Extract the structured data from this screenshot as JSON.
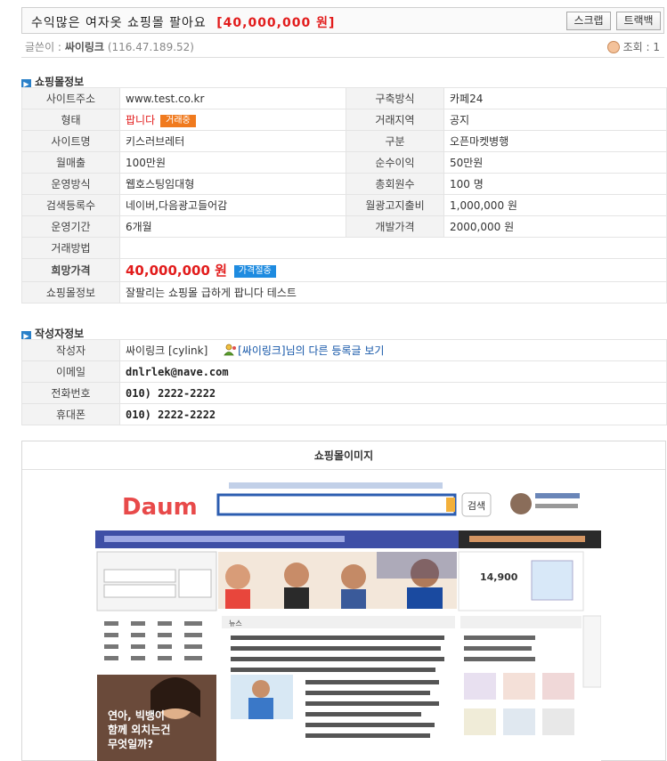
{
  "header": {
    "title": "수익많은 여자옷 쇼핑몰 팔아요",
    "price_tag": "[40,000,000 원]",
    "scrap_label": "스크랩",
    "trackback_label": "트랙백"
  },
  "meta": {
    "author_label": "글쓴이 :",
    "author_name": "싸이링크",
    "author_ip": "(116.47.189.52)",
    "views_label": "조회 : 1"
  },
  "shop_info": {
    "section_title": "쇼핑몰정보",
    "rows": [
      {
        "l1": "사이트주소",
        "v1": "www.test.co.kr",
        "l2": "구축방식",
        "v2": "카페24"
      },
      {
        "l1": "형태",
        "v1": "팝니다",
        "badge": "거래중",
        "l2": "거래지역",
        "v2": "공지"
      },
      {
        "l1": "사이트명",
        "v1": "키스러브레터",
        "l2": "구분",
        "v2": "오픈마켓병행"
      },
      {
        "l1": "월매출",
        "v1": "100만원",
        "l2": "순수이익",
        "v2": "50만원"
      },
      {
        "l1": "운영방식",
        "v1": "웹호스팅임대형",
        "l2": "총회원수",
        "v2": "100 명"
      },
      {
        "l1": "검색등록수",
        "v1": "네이버,다음광고들어감",
        "l2": "월광고지출비",
        "v2": "1,000,000 원"
      },
      {
        "l1": "운영기간",
        "v1": "6개월",
        "l2": "개발가격",
        "v2": "2000,000 원"
      }
    ],
    "method_label": "거래방법",
    "method_value": "",
    "price_label": "희망가격",
    "price_value": "40,000,000 원",
    "price_badge": "가격절충",
    "desc_label": "쇼핑몰정보",
    "desc_value": "잘팔리는 쇼핑몰 급하게 팝니다 테스트"
  },
  "author_info": {
    "section_title": "작성자정보",
    "writer_label": "작성자",
    "writer_value": "싸이링크 [cylink]",
    "writer_link_name": "[싸이링크]",
    "writer_link_suffix": "님의 다른 등록글 보기",
    "email_label": "이메일",
    "email_value": "dnlrlek@nave.com",
    "phone_label": "전화번호",
    "phone_value": "010) 2222-2222",
    "mobile_label": "휴대폰",
    "mobile_value": "010) 2222-2222"
  },
  "shop_image": {
    "section_title": "쇼핑몰이미지",
    "screenshot": {
      "logo": "Daum",
      "search_button": "검색",
      "promo_price": "14,900",
      "news_tab": "뉴스",
      "headline_1": "연아, 빅뱅이",
      "headline_2": "함께 외치는건",
      "headline_3": "무엇일까?"
    }
  },
  "colors": {
    "accent_red": "#e21c1c",
    "badge_orange": "#f07a1e",
    "badge_blue": "#1e8be0",
    "label_bg": "#f3f3f3",
    "link_blue": "#1456a8"
  }
}
